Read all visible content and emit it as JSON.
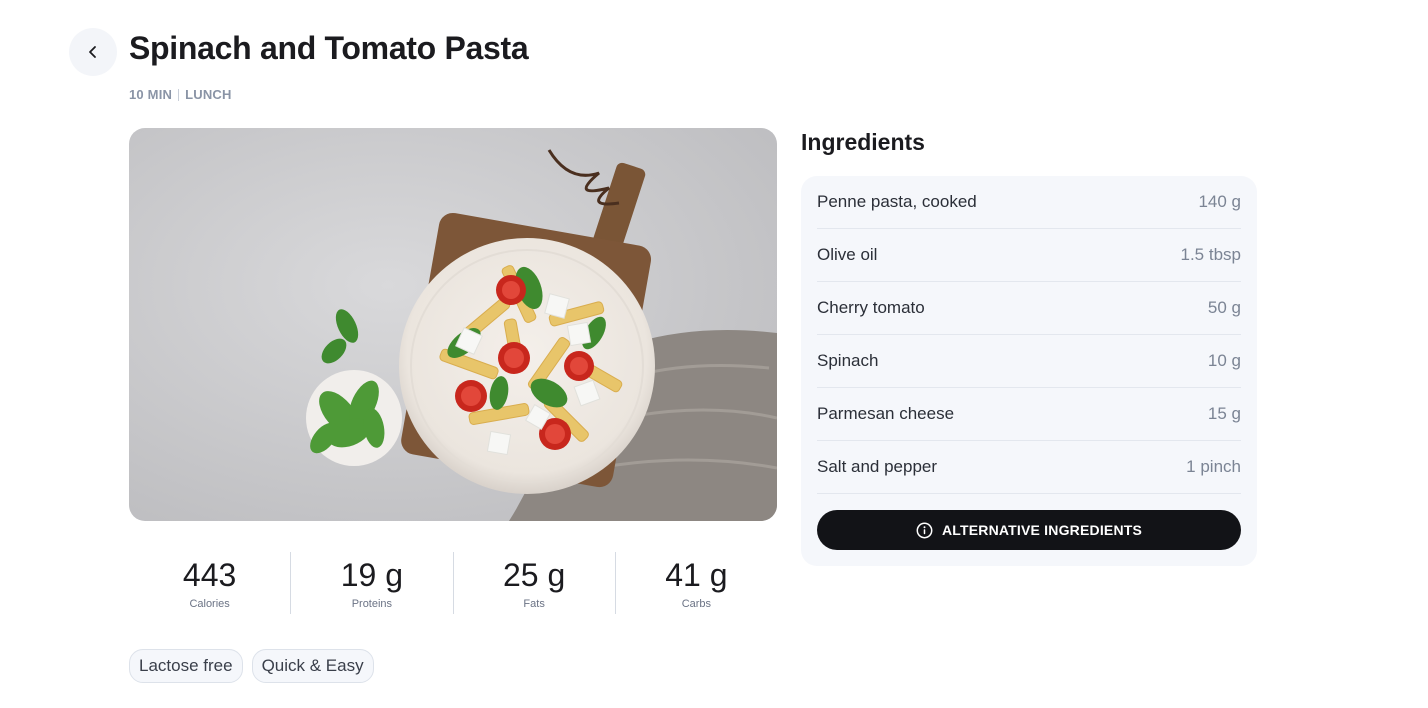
{
  "recipe": {
    "title": "Spinach and Tomato Pasta",
    "time": "10 MIN",
    "meal": "LUNCH"
  },
  "nutrition": [
    {
      "value": "443",
      "label": "Calories"
    },
    {
      "value": "19 g",
      "label": "Proteins"
    },
    {
      "value": "25 g",
      "label": "Fats"
    },
    {
      "value": "41 g",
      "label": "Carbs"
    }
  ],
  "tags": [
    "Lactose free",
    "Quick & Easy"
  ],
  "ingredients": {
    "title": "Ingredients",
    "items": [
      {
        "name": "Penne pasta, cooked",
        "qty": "140 g"
      },
      {
        "name": "Olive oil",
        "qty": "1.5 tbsp"
      },
      {
        "name": "Cherry tomato",
        "qty": "50 g"
      },
      {
        "name": "Spinach",
        "qty": "10 g"
      },
      {
        "name": "Parmesan cheese",
        "qty": "15 g"
      },
      {
        "name": "Salt and pepper",
        "qty": "1 pinch"
      }
    ],
    "alt_button": "ALTERNATIVE INGREDIENTS"
  },
  "icons": {
    "back": "chevron-left-icon",
    "info": "info-icon"
  },
  "colors": {
    "primary_button": "#121317",
    "card_background": "#f5f7fb",
    "muted_text": "#8a94a6"
  }
}
